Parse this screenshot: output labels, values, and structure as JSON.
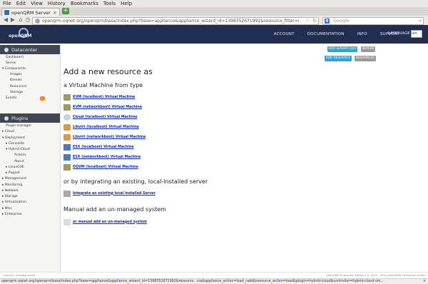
{
  "browser": {
    "menu": [
      "File",
      "Edit",
      "View",
      "History",
      "Bookmarks",
      "Tools",
      "Help"
    ],
    "tab_title": "openQRM Server",
    "new_tab": "+",
    "url": "openqrm.oqnet.org/openqrm/base/index.php?base=appliance&appliance_wizard_id=1398352671992&resource_filter=&appliance_action=",
    "search_placeholder": "Google",
    "search_engine_glyph": "g",
    "status_url": "openqrm.oqnet.org/openqrm/base/index.php?base=appliance&appliance_wizard_id=1398352671992&resource...rce&appliance_action=load_radd&resource_action=load&plugin=hybrid-cloud&controller=hybrid-cloud-vm..."
  },
  "header": {
    "logo_text": "openQRM",
    "nav": [
      "ACCOUNT",
      "DOCUMENTATION",
      "INFO",
      "SUPPORT"
    ],
    "language_label": "LANGUAGE",
    "language_value": "en"
  },
  "sidebar": {
    "datacenter_title": "Datacenter",
    "datacenter_items": [
      "Dashboard",
      "Server",
      "Components",
      "Images",
      "Kernels",
      "Resources",
      "Storage",
      "Events"
    ],
    "plugins_title": "Plugins",
    "plugins_items": [
      "Plugin manager",
      "Cloud",
      "Deployment",
      "Clonezilla",
      "Hybrid-Cloud",
      "Actions",
      "About",
      "LinuxCOE",
      "Puppet",
      "Management",
      "Monitoring",
      "Network",
      "Storage",
      "Virtualization",
      "Misc",
      "Enterprise"
    ]
  },
  "actions": {
    "add_server": "ADD SERVER (0/4)",
    "server": "SERVER",
    "add_resource": "ADD RESOURCE",
    "resources": "RESOURCES"
  },
  "main": {
    "title": "Add a new resource as",
    "vm_heading": "a Virtual Machine from type",
    "vm_types": [
      "KVM (localboot) Virtual Machine",
      "KVM (networkboot) Virtual Machine",
      "Cloud (localboot) Virtual Machine",
      "Libvirt (localboot) Virtual Machine",
      "Libvirt (networkboot) Virtual Machine",
      "ESX (localboot) Virtual Machine",
      "ESX (networkboot) Virtual Machine",
      "OQVM (localboot) Virtual Machine"
    ],
    "integrate_heading": "or by integrating an existing, local-installed server",
    "integrate_link": "Integrate an existing local installed Server",
    "manual_heading": "Manual add an un-managed system",
    "manual_link": "or manual add an un-managed system"
  },
  "footer": {
    "left": "memory: variable bytes",
    "right": "openQRM Enterprise Edition | © 2012 - 2014 openQRM Enterprise GmbH"
  },
  "colors": {
    "header_bg": "#222e50",
    "section_head_bg": "#3f4755",
    "button_blue": "#3aa0d0",
    "button_gray": "#9a9a9a",
    "link": "#0c27b0"
  }
}
